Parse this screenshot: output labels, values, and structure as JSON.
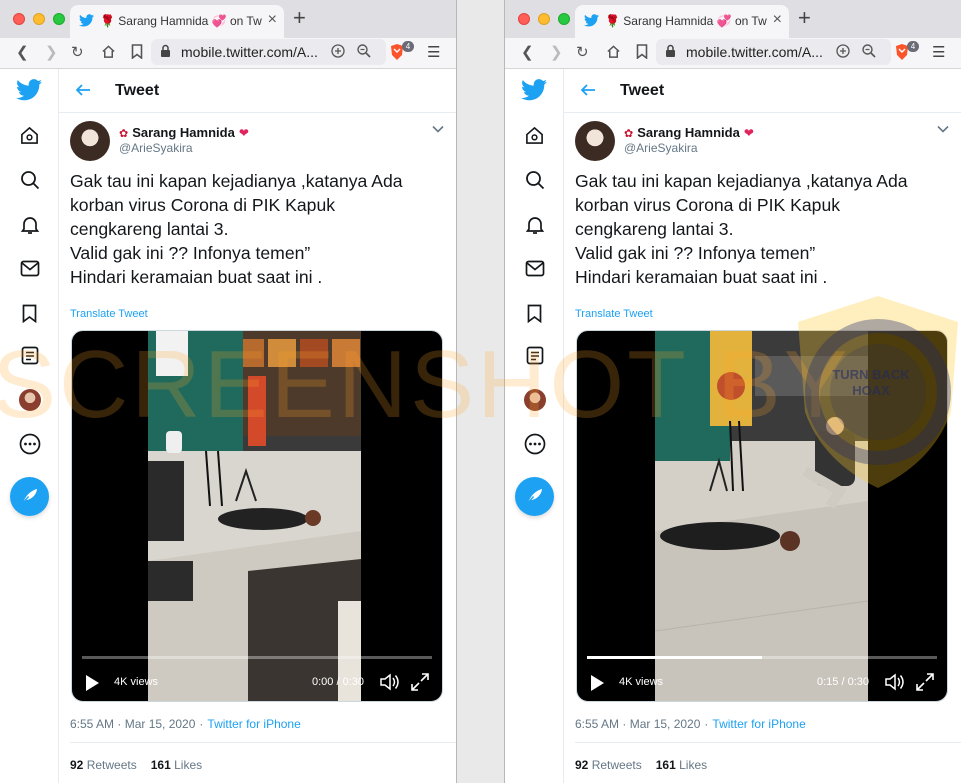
{
  "browser": {
    "tab_title": "🌹 Sarang Hamnida 💞 on Twitter:",
    "tab_close": "×",
    "new_tab": "+",
    "url": "mobile.twitter.com/A...",
    "shield_count": "4"
  },
  "header": {
    "title": "Tweet"
  },
  "tweet": {
    "display_name": "Sarang Hamnida",
    "handle": "@ArieSyakira",
    "text_lines": [
      "Gak tau ini kapan kejadianya ,katanya Ada",
      "korban virus Corona di PIK Kapuk",
      "cengkareng lantai 3.",
      "Valid gak ini ?? Infonya temen”",
      "Hindari keramaian buat saat ini ."
    ],
    "translate": "Translate Tweet",
    "timestamp": "6:55 AM · Mar 15, 2020",
    "separator": "·",
    "source": "Twitter for iPhone",
    "retweets": "92",
    "retweets_label": "Retweets",
    "likes": "161",
    "likes_label": "Likes"
  },
  "video_left": {
    "views": "4K views",
    "time": "0:00 / 0:30",
    "progress": 0.0
  },
  "video_right": {
    "views": "4K views",
    "time": "0:15 / 0:30",
    "progress": 0.5
  },
  "watermark": {
    "text": "SCREENSHOT BY",
    "badge_label": "TURN BACK HOAX",
    "badge_ring": "ANTI FITNAH INDONESIA · MAFINDO"
  },
  "colors": {
    "twitter_blue": "#1da1f2",
    "text": "#14171a",
    "muted": "#657786"
  }
}
